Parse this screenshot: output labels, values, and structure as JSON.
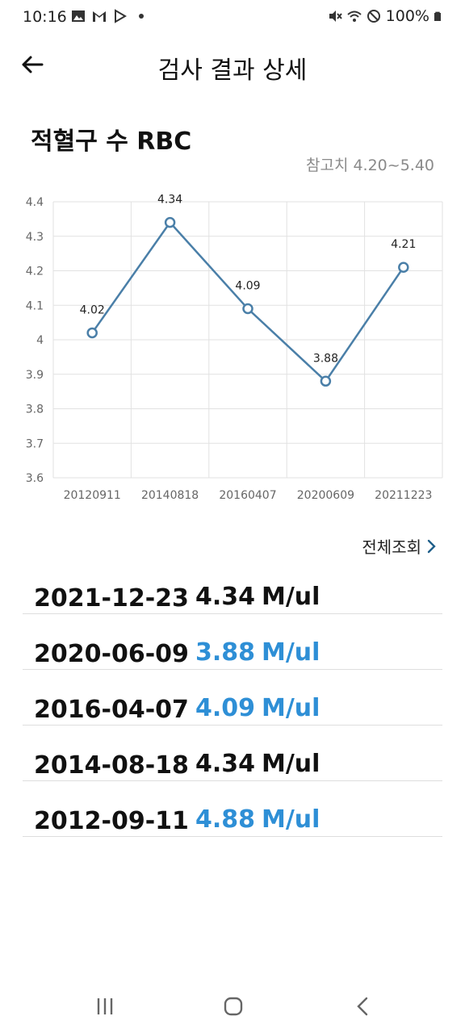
{
  "status_bar": {
    "time": "10:16",
    "battery": "100%",
    "left_icons": [
      "image-icon",
      "gmail-icon",
      "play-store-icon",
      "dot-icon"
    ],
    "right_icons": [
      "mute-icon",
      "wifi-icon",
      "dnd-icon",
      "battery-icon"
    ]
  },
  "app_bar": {
    "title": "검사 결과 상세",
    "back_icon": "back-arrow-icon"
  },
  "test": {
    "name": "적혈구 수 RBC",
    "reference": "참고치 4.20~5.40"
  },
  "colors": {
    "line": "#4a7fa8",
    "normal_value": "#111111",
    "abnormal_value": "#2e8fd6"
  },
  "chart_data": {
    "type": "line",
    "categories": [
      "20120911",
      "20140818",
      "20160407",
      "20200609",
      "20211223"
    ],
    "values": [
      4.02,
      4.34,
      4.09,
      3.88,
      4.21
    ],
    "data_labels": [
      "4.02",
      "4.34",
      "4.09",
      "3.88",
      "4.21"
    ],
    "yticks": [
      "4.4",
      "4.3",
      "4.2",
      "4.1",
      "4",
      "3.9",
      "3.8",
      "3.7",
      "3.6"
    ],
    "ylim": [
      3.6,
      4.4
    ],
    "grid": true,
    "legend": "none"
  },
  "view_all": {
    "label": "전체조회",
    "icon": "chevron-right-icon"
  },
  "results": [
    {
      "date": "2021-12-23",
      "value": "4.34",
      "unit": "M/ul",
      "abnormal": false
    },
    {
      "date": "2020-06-09",
      "value": "3.88",
      "unit": "M/ul",
      "abnormal": true
    },
    {
      "date": "2016-04-07",
      "value": "4.09",
      "unit": "M/ul",
      "abnormal": true
    },
    {
      "date": "2014-08-18",
      "value": "4.34",
      "unit": "M/ul",
      "abnormal": false
    },
    {
      "date": "2012-09-11",
      "value": "4.88",
      "unit": "M/ul",
      "abnormal": true
    }
  ],
  "nav_bar": {
    "items": [
      "recent-apps-icon",
      "home-icon",
      "back-icon"
    ]
  }
}
